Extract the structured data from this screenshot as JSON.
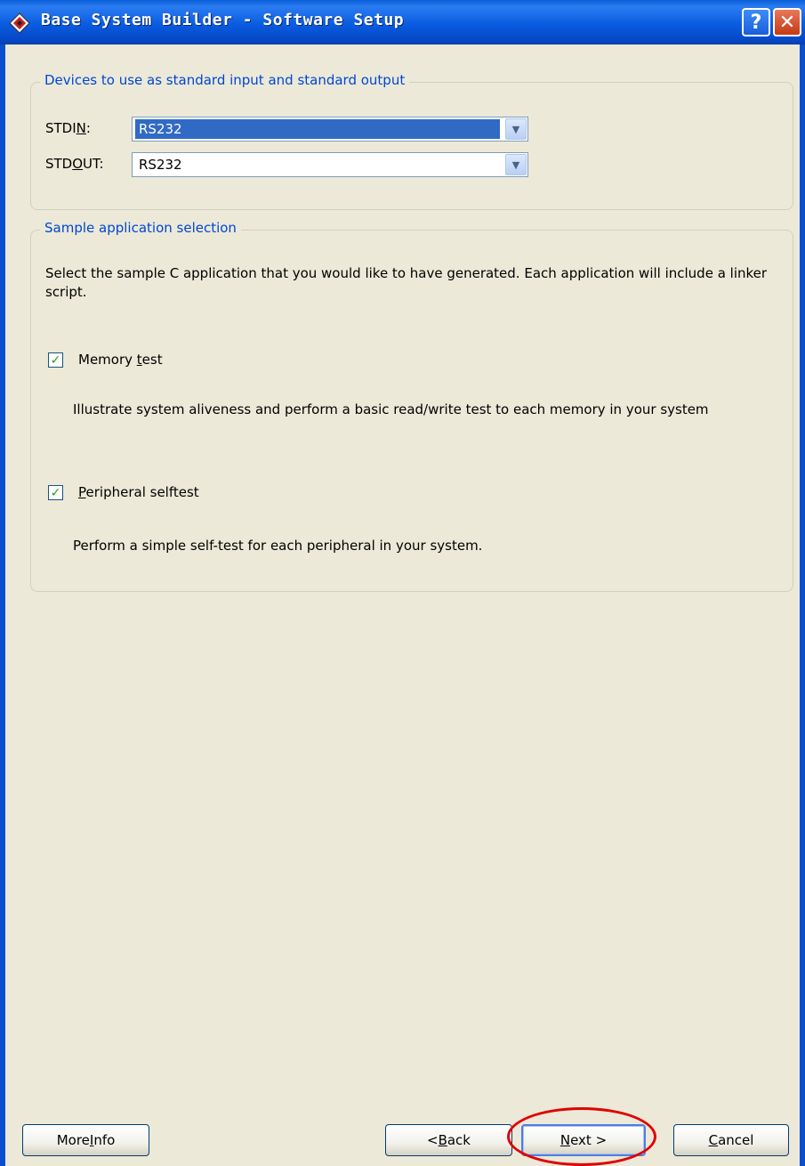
{
  "window": {
    "title": "Base System Builder - Software Setup"
  },
  "titlebar": {
    "help_glyph": "?",
    "close_glyph": "✕"
  },
  "stdio": {
    "legend": "Devices to use as standard input and standard output",
    "stdin": {
      "label_pre": "STDI",
      "label_mnemonic": "N",
      "label_post": ":",
      "value": "RS232"
    },
    "stdout": {
      "label_pre": "STD",
      "label_mnemonic": "O",
      "label_post": "UT:",
      "value": "RS232"
    }
  },
  "sample_app": {
    "legend": "Sample application selection",
    "description": "Select the sample C application that you would like to have generated.  Each application will include a linker script.",
    "memory_test": {
      "label_pre": "Memory ",
      "label_mnemonic": "t",
      "label_post": "est",
      "checked": true,
      "description": "Illustrate system aliveness and perform a basic read/write test to each memory in your system"
    },
    "peripheral_selftest": {
      "label_pre": "",
      "label_mnemonic": "P",
      "label_post": "eripheral selftest",
      "checked": true,
      "description": "Perform a simple self-test for each peripheral in your system."
    }
  },
  "buttons": {
    "more_info": {
      "pre": "More ",
      "mnemonic": "I",
      "post": "nfo"
    },
    "back": {
      "pre": "< ",
      "mnemonic": "B",
      "post": "ack"
    },
    "next": {
      "pre": "",
      "mnemonic": "N",
      "post": "ext >"
    },
    "cancel": {
      "pre": "",
      "mnemonic": "C",
      "post": "ancel"
    }
  },
  "icons": {
    "dropdown_arrow": "chevron-down-icon",
    "checkmark": "✓",
    "highlight": "red-circle-annotation"
  },
  "colors": {
    "title_bar": "#0a5ce0",
    "legend_text": "#0046d5",
    "selection": "#316ac5",
    "annotation": "#e00000",
    "checkmark": "#21a121"
  }
}
